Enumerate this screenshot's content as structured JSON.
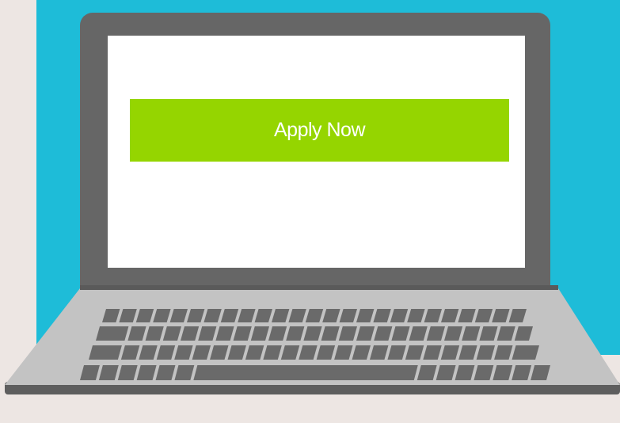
{
  "screen": {
    "cta_label": "Apply Now"
  },
  "colors": {
    "backdrop": "#1ebcd8",
    "page_background": "#ede6e3",
    "laptop_lid": "#666666",
    "screen": "#ffffff",
    "cta_button": "#95d500",
    "cta_text": "#ffffff",
    "laptop_base": "#c3c3c3",
    "keys": "#6a6a6a"
  },
  "icons": {
    "device": "laptop-icon",
    "keyboard": "keyboard-icon"
  }
}
